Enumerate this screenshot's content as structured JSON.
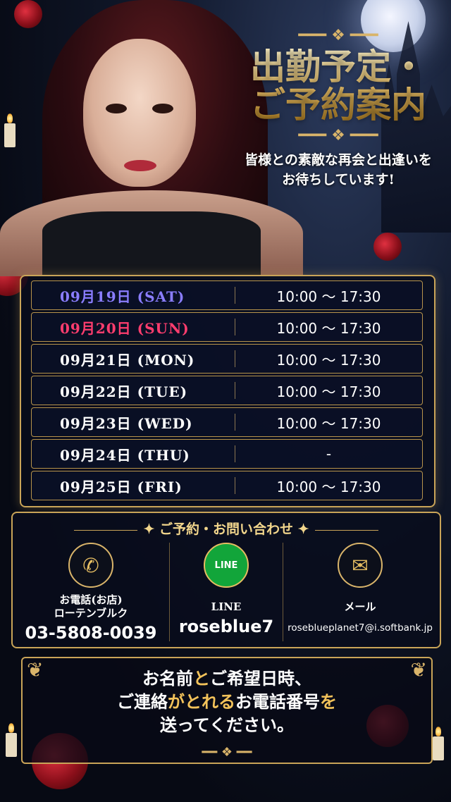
{
  "header": {
    "title_line1": "出勤予定・",
    "title_line2": "ご予約案内",
    "subtitle_line1": "皆様との素敵な再会と出逢いを",
    "subtitle_line2": "お待ちしています!"
  },
  "schedule": [
    {
      "date": "09月19日 (SAT)",
      "time": "10:00 〜 17:30",
      "day_type": "sat"
    },
    {
      "date": "09月20日 (SUN)",
      "time": "10:00 〜 17:30",
      "day_type": "sun"
    },
    {
      "date": "09月21日 (MON)",
      "time": "10:00 〜 17:30",
      "day_type": "weekday"
    },
    {
      "date": "09月22日 (TUE)",
      "time": "10:00 〜 17:30",
      "day_type": "weekday"
    },
    {
      "date": "09月23日 (WED)",
      "time": "10:00 〜 17:30",
      "day_type": "weekday"
    },
    {
      "date": "09月24日 (THU)",
      "time": "-",
      "day_type": "weekday"
    },
    {
      "date": "09月25日 (FRI)",
      "time": "10:00 〜 17:30",
      "day_type": "weekday"
    }
  ],
  "contact": {
    "heading": "ご予約・お問い合わせ",
    "phone": {
      "icon": "phone-icon",
      "label_line1": "お電話(お店)",
      "label_line2": "ローテンブルク",
      "number": "03-5808-0039"
    },
    "line": {
      "icon": "line-icon",
      "icon_text": "LINE",
      "label": "LINE",
      "id": "roseblue7"
    },
    "mail": {
      "icon": "mail-icon",
      "label": "メール",
      "address": "roseblueplanet7@i.softbank.jp"
    }
  },
  "note": {
    "line1_a": "お名前",
    "line1_b": "と",
    "line1_c": "ご希望日時、",
    "line2_a": "ご連絡",
    "line2_b": "がとれる",
    "line2_c": "お電話番号",
    "line2_d": "を",
    "line3": "送ってください。"
  },
  "colors": {
    "gold": "#c9a458",
    "sat": "#8a7dff",
    "sun": "#ff3d6e",
    "line_green": "#12a53a"
  }
}
